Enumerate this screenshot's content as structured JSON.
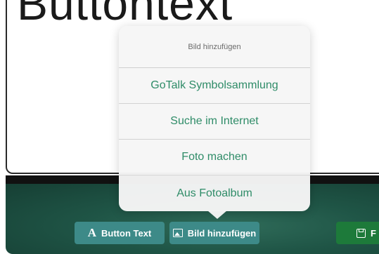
{
  "canvas": {
    "preview_text": "Buttontext"
  },
  "popover": {
    "title": "Bild hinzufügen",
    "items": [
      "GoTalk Symbolsammlung",
      "Suche im Internet",
      "Foto machen",
      "Aus Fotoalbum"
    ]
  },
  "toolbar": {
    "button_text_label": "Button Text",
    "add_image_label": "Bild hinzufügen",
    "save_label": "F",
    "text_icon": "A"
  },
  "colors": {
    "accent_green": "#2f8c68",
    "toolbar_teal": "#3d8a88",
    "save_green": "#1d7a3a",
    "background_dark_green": "#1f5546"
  },
  "icons": {
    "text": "text-a-icon",
    "image": "image-icon",
    "save": "save-disk-icon"
  }
}
